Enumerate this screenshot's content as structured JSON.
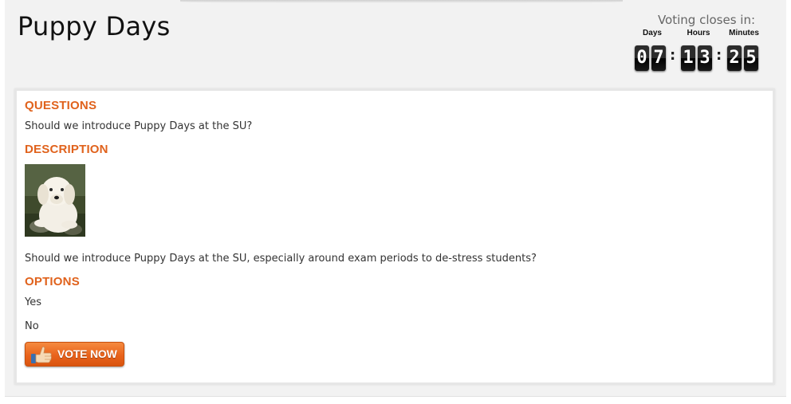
{
  "page": {
    "title": "Puppy Days"
  },
  "countdown": {
    "heading": "Voting closes in:",
    "labels": {
      "days": "Days",
      "hours": "Hours",
      "minutes": "Minutes"
    },
    "digits": {
      "days": [
        "0",
        "7"
      ],
      "hours": [
        "1",
        "3"
      ],
      "minutes": [
        "2",
        "5"
      ]
    },
    "separator": ":"
  },
  "content": {
    "questions_heading": "QUESTIONS",
    "question": "Should we introduce Puppy Days at the SU?",
    "description_heading": "DESCRIPTION",
    "description": "Should we introduce Puppy Days at the SU, especially around exam periods to de-stress students?",
    "options_heading": "OPTIONS",
    "options": [
      "Yes",
      "No"
    ],
    "vote_button_label": "VOTE NOW"
  },
  "colors": {
    "accent": "#e0621c",
    "button": "#e9631c"
  }
}
